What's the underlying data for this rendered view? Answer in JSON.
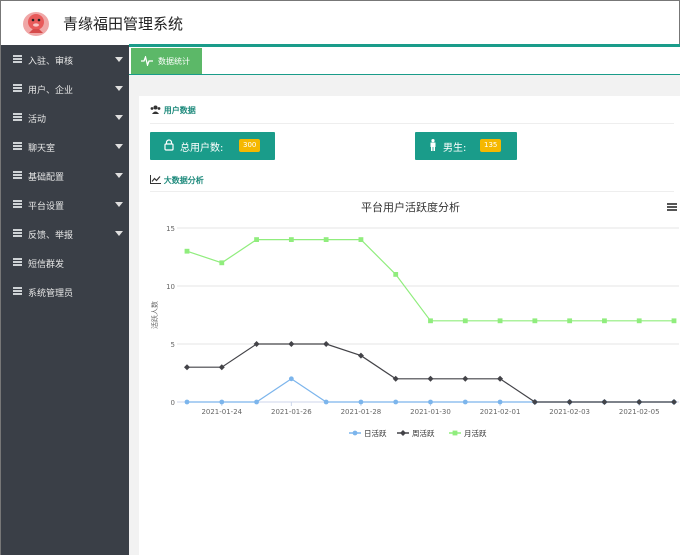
{
  "app": {
    "title": "青缘福田管理系统"
  },
  "sidebar": {
    "items": [
      {
        "label": "入驻、审核",
        "caret": true
      },
      {
        "label": "用户、企业",
        "caret": true
      },
      {
        "label": "活动",
        "caret": true
      },
      {
        "label": "聊天室",
        "caret": true
      },
      {
        "label": "基础配置",
        "caret": true
      },
      {
        "label": "平台设置",
        "caret": true
      },
      {
        "label": "反馈、举报",
        "caret": true
      },
      {
        "label": "短信群发",
        "caret": false
      },
      {
        "label": "系统管理员",
        "caret": false
      }
    ]
  },
  "tabs": [
    {
      "label": "数据统计",
      "active": true
    }
  ],
  "user_section": {
    "title": "用户数据"
  },
  "stats": {
    "total_label": "总用户数:",
    "total_value": "300",
    "male_label": "男生:",
    "male_value": "135"
  },
  "analysis_section": {
    "title": "大数据分析"
  },
  "colors": {
    "accent": "#1a9c8a",
    "tab": "#5cb868",
    "badge": "#f5b800",
    "sidebar": "#3a3f47"
  },
  "chart_data": {
    "type": "line",
    "title": "平台用户活跃度分析",
    "ylabel": "活跃人数",
    "xlabel": "",
    "ylim": [
      0,
      15
    ],
    "yticks": [
      0,
      5,
      10,
      15
    ],
    "x": [
      "2021-01-23",
      "2021-01-24",
      "2021-01-25",
      "2021-01-26",
      "2021-01-27",
      "2021-01-28",
      "2021-01-29",
      "2021-01-30",
      "2021-01-31",
      "2021-02-01",
      "2021-02-02",
      "2021-02-03",
      "2021-02-04",
      "2021-02-05",
      "2021-02-06"
    ],
    "xtick_labels": [
      "2021-01-24",
      "2021-01-26",
      "2021-01-28",
      "2021-01-30",
      "2021-02-01",
      "2021-02-03",
      "2021-02-05"
    ],
    "grid": true,
    "legend": "bottom",
    "series": [
      {
        "name": "日活跃",
        "color": "#7cb5ec",
        "marker": "circle",
        "values": [
          0,
          0,
          0,
          2,
          0,
          0,
          0,
          0,
          0,
          0,
          0,
          0,
          0,
          0,
          0
        ]
      },
      {
        "name": "周活跃",
        "color": "#434348",
        "marker": "diamond",
        "values": [
          3,
          3,
          5,
          5,
          5,
          4,
          2,
          2,
          2,
          2,
          0,
          0,
          0,
          0,
          0
        ]
      },
      {
        "name": "月活跃",
        "color": "#90ed7d",
        "marker": "square",
        "values": [
          13,
          12,
          14,
          14,
          14,
          14,
          11,
          7,
          7,
          7,
          7,
          7,
          7,
          7,
          7
        ]
      }
    ]
  }
}
